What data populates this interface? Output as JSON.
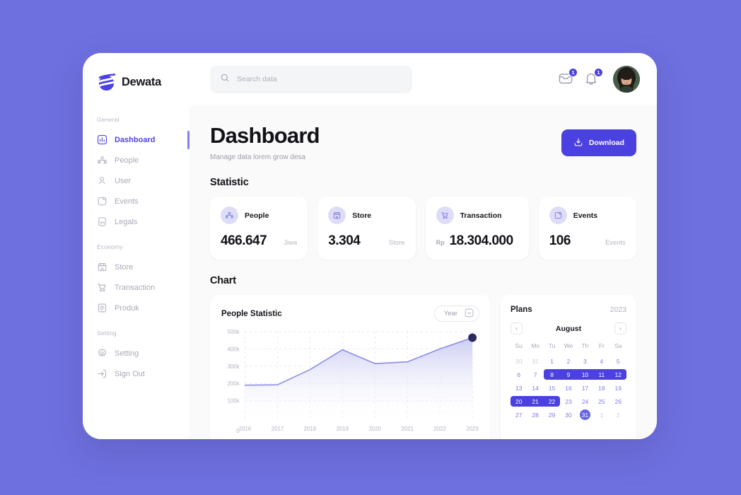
{
  "brand": {
    "name": "Dewata"
  },
  "search": {
    "placeholder": "Search data",
    "value": ""
  },
  "topbar": {
    "mail_badge": "1",
    "bell_badge": "1"
  },
  "sidebar": {
    "groups": [
      {
        "label": "General",
        "items": [
          {
            "label": "Dashboard",
            "icon": "chart-bar-icon",
            "active": true
          },
          {
            "label": "People",
            "icon": "people-group-icon",
            "active": false
          },
          {
            "label": "User",
            "icon": "user-icon",
            "active": false
          },
          {
            "label": "Events",
            "icon": "calendar-note-icon",
            "active": false
          },
          {
            "label": "Legals",
            "icon": "document-icon",
            "active": false
          }
        ]
      },
      {
        "label": "Economy",
        "items": [
          {
            "label": "Store",
            "icon": "store-icon",
            "active": false
          },
          {
            "label": "Transaction",
            "icon": "cart-icon",
            "active": false
          },
          {
            "label": "Produk",
            "icon": "list-icon",
            "active": false
          }
        ]
      },
      {
        "label": "Setting",
        "items": [
          {
            "label": "Setting",
            "icon": "gear-icon",
            "active": false
          },
          {
            "label": "Sign Out",
            "icon": "sign-out-icon",
            "active": false
          }
        ]
      }
    ]
  },
  "page": {
    "title": "Dashboard",
    "subtitle": "Manage data lorem grow desa",
    "download_label": "Download"
  },
  "statistic": {
    "section_title": "Statistic",
    "cards": [
      {
        "label": "People",
        "prefix": "",
        "value": "466.647",
        "unit": "Jiwa",
        "icon": "people-group-icon"
      },
      {
        "label": "Store",
        "prefix": "",
        "value": "3.304",
        "unit": "Store",
        "icon": "store-icon"
      },
      {
        "label": "Transaction",
        "prefix": "Rp",
        "value": "18.304.000",
        "unit": "",
        "icon": "cart-icon"
      },
      {
        "label": "Events",
        "prefix": "",
        "value": "106",
        "unit": "Events",
        "icon": "calendar-note-icon"
      }
    ]
  },
  "chart_section": {
    "section_title": "Chart",
    "card_title": "People Statistic",
    "range_label": "Year"
  },
  "chart_data": {
    "type": "area",
    "title": "People Statistic",
    "xlabel": "",
    "ylabel": "",
    "categories": [
      "2016",
      "2017",
      "2018",
      "2019",
      "2020",
      "2021",
      "2022",
      "2023"
    ],
    "values": [
      190000,
      192000,
      280000,
      395000,
      315000,
      325000,
      400000,
      465000
    ],
    "ytick_labels": [
      "0",
      "100k",
      "200k",
      "300k",
      "400k",
      "500k"
    ],
    "ytick_values": [
      0,
      100000,
      200000,
      300000,
      400000,
      500000
    ],
    "ylim": [
      0,
      500000
    ],
    "grid": true,
    "legend": "none",
    "line_color": "#8b8ce8",
    "fill_color": "#c9caf2",
    "marker": {
      "x": "2023",
      "y": 465000,
      "color": "#2a2a5e"
    }
  },
  "calendar": {
    "title": "Plans",
    "year": "2023",
    "month": "August",
    "prev_label": "‹",
    "next_label": "›",
    "dow": [
      "Su",
      "Mo",
      "Tu",
      "We",
      "Th",
      "Fr",
      "Sa"
    ],
    "weeks": [
      [
        {
          "d": "30",
          "s": "muted"
        },
        {
          "d": "31",
          "s": "muted"
        },
        {
          "d": "1",
          "s": "normal"
        },
        {
          "d": "2",
          "s": "normal"
        },
        {
          "d": "3",
          "s": "normal"
        },
        {
          "d": "4",
          "s": "normal"
        },
        {
          "d": "5",
          "s": "normal"
        }
      ],
      [
        {
          "d": "6",
          "s": "normal"
        },
        {
          "d": "7",
          "s": "normal"
        },
        {
          "d": "8",
          "s": "in-range"
        },
        {
          "d": "9",
          "s": "in-range"
        },
        {
          "d": "10",
          "s": "in-range"
        },
        {
          "d": "11",
          "s": "in-range"
        },
        {
          "d": "12",
          "s": "in-range"
        }
      ],
      [
        {
          "d": "13",
          "s": "normal"
        },
        {
          "d": "14",
          "s": "normal"
        },
        {
          "d": "15",
          "s": "normal"
        },
        {
          "d": "16",
          "s": "normal"
        },
        {
          "d": "17",
          "s": "normal"
        },
        {
          "d": "18",
          "s": "normal"
        },
        {
          "d": "19",
          "s": "normal"
        }
      ],
      [
        {
          "d": "20",
          "s": "in-range"
        },
        {
          "d": "21",
          "s": "in-range"
        },
        {
          "d": "22",
          "s": "in-range"
        },
        {
          "d": "23",
          "s": "normal"
        },
        {
          "d": "24",
          "s": "normal"
        },
        {
          "d": "25",
          "s": "normal"
        },
        {
          "d": "26",
          "s": "normal"
        }
      ],
      [
        {
          "d": "27",
          "s": "normal"
        },
        {
          "d": "28",
          "s": "normal"
        },
        {
          "d": "29",
          "s": "normal"
        },
        {
          "d": "30",
          "s": "normal"
        },
        {
          "d": "31",
          "s": "selected"
        },
        {
          "d": "1",
          "s": "muted"
        },
        {
          "d": "2",
          "s": "muted"
        }
      ]
    ],
    "ranges": [
      {
        "week": 1,
        "start": 2,
        "end": 6
      },
      {
        "week": 3,
        "start": 0,
        "end": 2
      }
    ]
  },
  "colors": {
    "background": "#6F70E0",
    "accent": "#4B40E0",
    "accent_soft": "#DDDDF8",
    "chart_line": "#8B8CE8"
  }
}
